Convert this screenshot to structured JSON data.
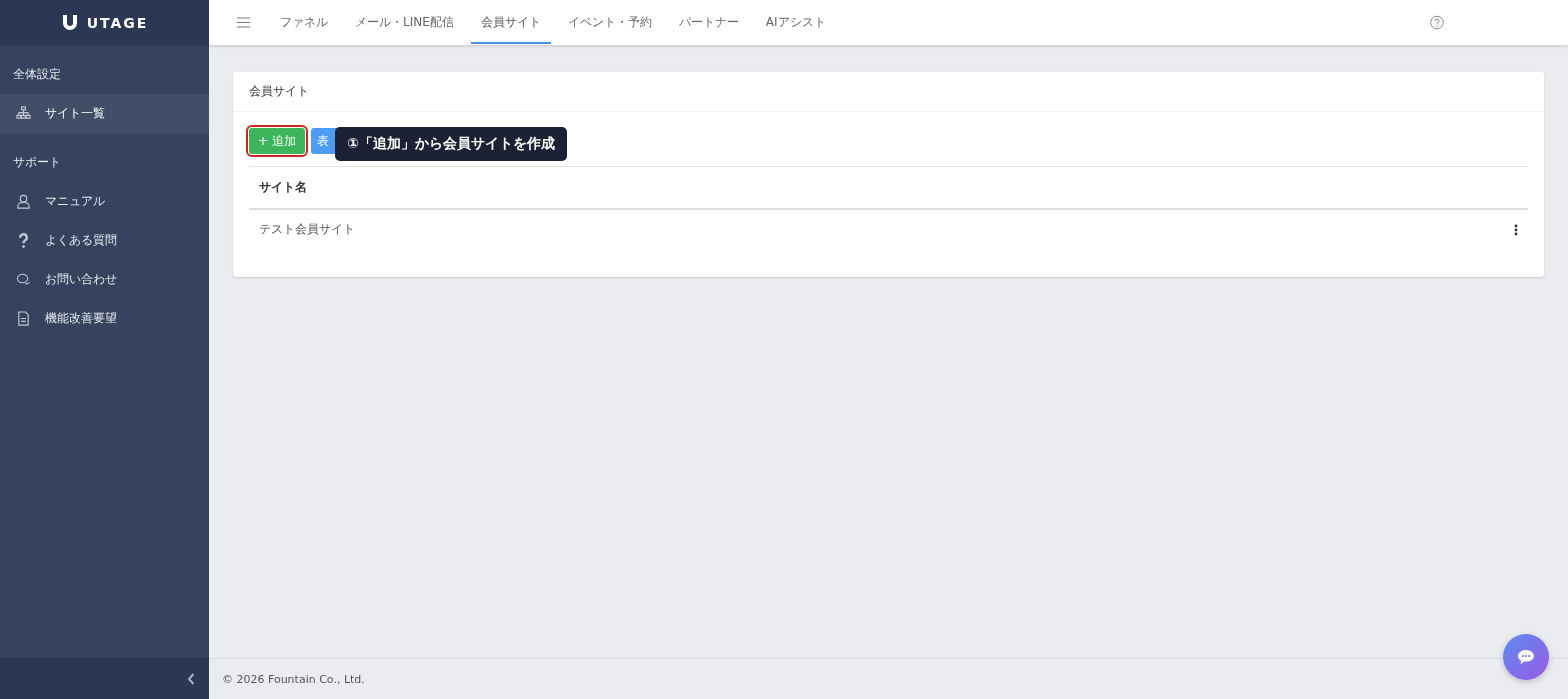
{
  "sidebar": {
    "logo": "UTAGE",
    "sections": [
      {
        "title": "全体設定",
        "items": [
          {
            "label": "サイト一覧",
            "kind": "sitemap",
            "selected": true
          }
        ]
      },
      {
        "title": "サポート",
        "items": [
          {
            "label": "マニュアル",
            "kind": "person",
            "selected": false
          },
          {
            "label": "よくある質問",
            "kind": "question",
            "selected": false
          },
          {
            "label": "お問い合わせ",
            "kind": "chat",
            "selected": false
          },
          {
            "label": "機能改善要望",
            "kind": "document",
            "selected": false
          }
        ]
      }
    ]
  },
  "tabs": [
    {
      "label": "ファネル",
      "selected": false
    },
    {
      "label": "メール・LINE配信",
      "selected": false
    },
    {
      "label": "会員サイト",
      "selected": true
    },
    {
      "label": "イベント・予約",
      "selected": false
    },
    {
      "label": "パートナー",
      "selected": false
    },
    {
      "label": "AIアシスト",
      "selected": false
    }
  ],
  "card": {
    "title": "会員サイト",
    "buttons": [
      {
        "label": "+ 追加",
        "kind": "add",
        "highlighted": true
      },
      {
        "label": "表",
        "kind": "display",
        "highlighted": false
      }
    ],
    "callout": "①「追加」から会員サイトを作成",
    "table": {
      "columns": [
        "サイト名"
      ],
      "rows": [
        [
          "テスト会員サイト"
        ]
      ]
    }
  },
  "footer": "© 2026 Fountain Co., Ltd."
}
